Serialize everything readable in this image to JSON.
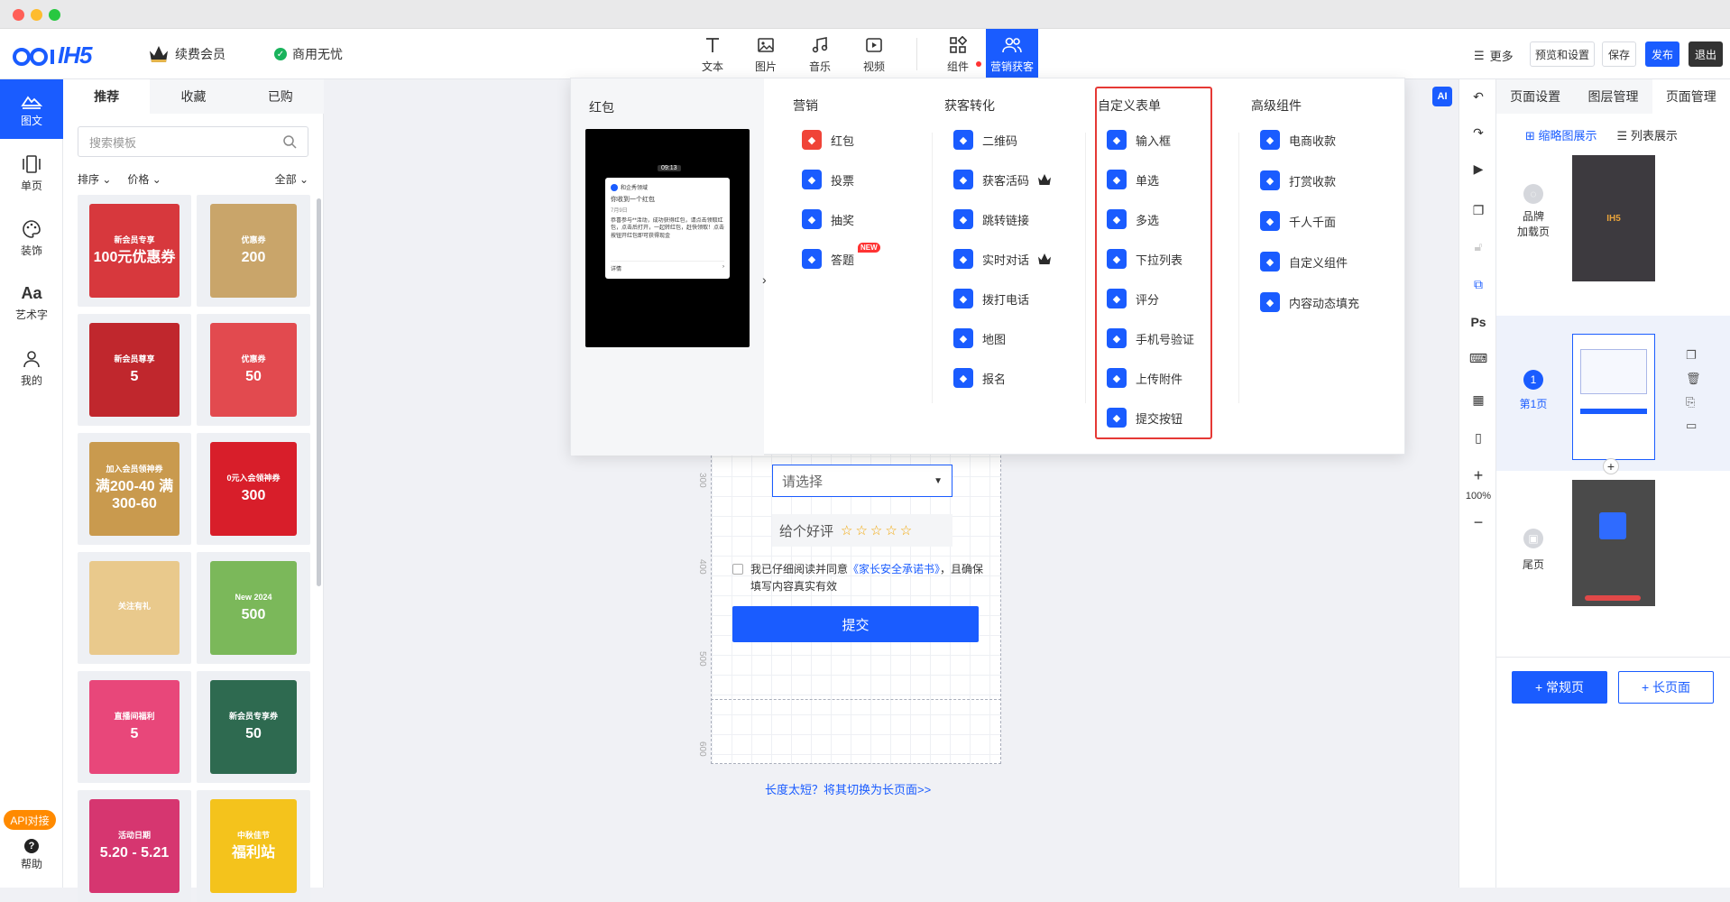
{
  "app": {
    "logo": "IH5",
    "member": "续费会员",
    "commercial": "商用无忧"
  },
  "toolbar": {
    "tools": [
      {
        "label": "文本",
        "icon": "text-icon"
      },
      {
        "label": "图片",
        "icon": "image-icon"
      },
      {
        "label": "音乐",
        "icon": "music-icon"
      },
      {
        "label": "视频",
        "icon": "video-icon"
      },
      {
        "label": "组件",
        "icon": "components-icon"
      },
      {
        "label": "营销获客",
        "icon": "marketing-icon"
      }
    ],
    "more": "更多",
    "preview": "预览和设置",
    "save": "保存",
    "publish": "发布",
    "exit": "退出"
  },
  "leftnav": {
    "items": [
      "图文",
      "单页",
      "装饰",
      "艺术字",
      "我的"
    ],
    "api": "API对接",
    "help": "帮助"
  },
  "templates": {
    "tabs": [
      "推荐",
      "收藏",
      "已购"
    ],
    "search_placeholder": "搜索模板",
    "filters": {
      "sort": "排序",
      "price": "价格",
      "all": "全部"
    },
    "cards": [
      {
        "title": "新会员专享",
        "value": "100元优惠券",
        "color": "#d7383d"
      },
      {
        "title": "优惠券",
        "value": "200",
        "color": "#c9a56a"
      },
      {
        "title": "新会员尊享",
        "value": "5",
        "color": "#c0272d"
      },
      {
        "title": "优惠券",
        "value": "50",
        "color": "#e24a4f"
      },
      {
        "title": "加入会员领神券",
        "value": "满200-40 满300-60",
        "color": "#c99a4e"
      },
      {
        "title": "0元入会领神券",
        "value": "300",
        "color": "#d81e2a"
      },
      {
        "title": "关注有礼",
        "value": "",
        "color": "#e9c98c"
      },
      {
        "title": "New 2024",
        "value": "500",
        "color": "#7bb85a"
      },
      {
        "title": "直播间福利",
        "value": "5",
        "color": "#e8477a"
      },
      {
        "title": "新会员专享券",
        "value": "50",
        "color": "#2e6a50"
      },
      {
        "title": "活动日期",
        "value": "5.20 - 5.21",
        "color": "#d63670"
      },
      {
        "title": "中秋佳节",
        "value": "福利站",
        "color": "#f4c31c"
      }
    ]
  },
  "popup": {
    "left_title": "红包",
    "preview": {
      "time": "09:13",
      "sender": "和企秀领域",
      "title": "你收到一个红包",
      "date": "7月9日",
      "body": "恭喜参与**活动，成功获得红包，请点击领取红包，点击后打开，一起转红包，赶快领取！点击按钮开红包即可获得现金",
      "detail": "详情"
    },
    "columns": [
      {
        "title": "营销",
        "items": [
          {
            "label": "红包",
            "icon": "red-packet-icon",
            "color": "#f04438"
          },
          {
            "label": "投票",
            "icon": "vote-icon",
            "color": "#1a5cff"
          },
          {
            "label": "抽奖",
            "icon": "lottery-icon",
            "color": "#1a5cff"
          },
          {
            "label": "答题",
            "icon": "quiz-icon",
            "color": "#1a5cff",
            "tag": "NEW"
          }
        ]
      },
      {
        "title": "获客转化",
        "items": [
          {
            "label": "二维码",
            "icon": "qrcode-icon",
            "color": "#1a5cff"
          },
          {
            "label": "获客活码",
            "icon": "live-code-icon",
            "color": "#1a5cff",
            "vip": true
          },
          {
            "label": "跳转链接",
            "icon": "link-icon",
            "color": "#1a5cff"
          },
          {
            "label": "实时对话",
            "icon": "chat-icon",
            "color": "#1a5cff",
            "vip": true
          },
          {
            "label": "拨打电话",
            "icon": "phone-icon",
            "color": "#1a5cff"
          },
          {
            "label": "地图",
            "icon": "map-icon",
            "color": "#1a5cff"
          },
          {
            "label": "报名",
            "icon": "signup-icon",
            "color": "#1a5cff"
          }
        ]
      },
      {
        "title": "自定义表单",
        "items": [
          {
            "label": "输入框",
            "icon": "input-icon",
            "color": "#1a5cff"
          },
          {
            "label": "单选",
            "icon": "radio-icon",
            "color": "#1a5cff"
          },
          {
            "label": "多选",
            "icon": "checkbox-icon",
            "color": "#1a5cff"
          },
          {
            "label": "下拉列表",
            "icon": "dropdown-icon",
            "color": "#1a5cff"
          },
          {
            "label": "评分",
            "icon": "rating-icon",
            "color": "#1a5cff"
          },
          {
            "label": "手机号验证",
            "icon": "phone-verify-icon",
            "color": "#1a5cff"
          },
          {
            "label": "上传附件",
            "icon": "upload-icon",
            "color": "#1a5cff"
          },
          {
            "label": "提交按钮",
            "icon": "submit-icon",
            "color": "#1a5cff"
          }
        ]
      },
      {
        "title": "高级组件",
        "items": [
          {
            "label": "电商收款",
            "icon": "ecommerce-icon",
            "color": "#1a5cff"
          },
          {
            "label": "打赏收款",
            "icon": "tip-icon",
            "color": "#1a5cff"
          },
          {
            "label": "千人千面",
            "icon": "personalize-icon",
            "color": "#1a5cff"
          },
          {
            "label": "自定义组件",
            "icon": "custom-component-icon",
            "color": "#1a5cff"
          },
          {
            "label": "内容动态填充",
            "icon": "dynamic-fill-icon",
            "color": "#1a5cff"
          }
        ]
      }
    ]
  },
  "canvas": {
    "ruler": [
      "300",
      "400",
      "500",
      "600"
    ],
    "select_placeholder": "请选择",
    "rating_label": "给个好评",
    "rating_stars": "☆☆☆☆☆",
    "agree_prefix": "我已仔细阅读并同意",
    "agree_link": "《家长安全承诺书》",
    "agree_suffix": "，且确保填写内容真实有效",
    "submit": "提交",
    "too_short": "长度太短？将其切换为长页面>>"
  },
  "side_tools": {
    "ai": "AI",
    "zoom": "100%"
  },
  "rightpanel": {
    "tabs": [
      "页面设置",
      "图层管理",
      "页面管理"
    ],
    "views": [
      "缩略图展示",
      "列表展示"
    ],
    "pages": [
      {
        "label": "品牌\n加载页",
        "thumb_text": "IH5"
      },
      {
        "label": "第1页",
        "number": "1"
      },
      {
        "label": "尾页"
      }
    ],
    "add_normal": "+ 常规页",
    "add_long": "+ 长页面"
  }
}
